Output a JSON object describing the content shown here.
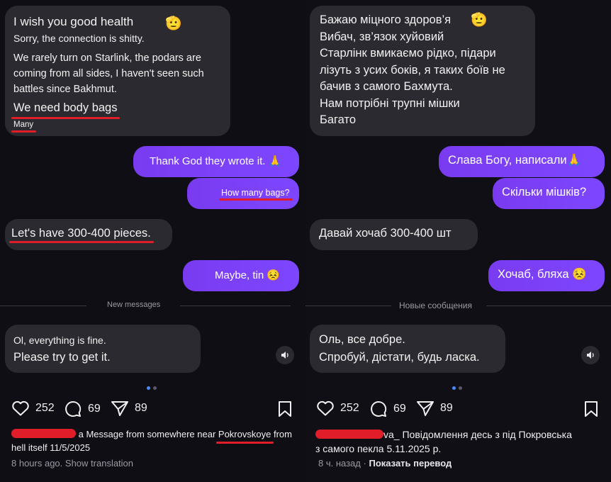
{
  "left": {
    "bubble1": {
      "line1": "I wish you good health",
      "line2": "Sorry, the connection is shitty.",
      "line3": "We rarely turn on Starlink, the podars are",
      "line4": "coming from all sides, I haven't seen such",
      "line5": "battles since Bakhmut.",
      "line6": "We need body bags",
      "line7": "Many"
    },
    "out1": "Thank God they wrote it.",
    "out2": "How many bags?",
    "in2": "Let's have 300-400 pieces.",
    "out3": "Maybe, tin",
    "divider": "New messages",
    "bubble3": {
      "line1": "Ol, everything is fine.",
      "line2": "Please try to get it."
    },
    "likes": "252",
    "comments": "69",
    "shares": "89",
    "caption_pre": "a Message from somewhere near",
    "caption_place": "Pokrovskoye",
    "caption_post": "from",
    "caption_line2": "hell itself 11/5/2025",
    "time": "8 hours ago.",
    "show_translation": "Show translation"
  },
  "right": {
    "bubble1": {
      "line1": "Бажаю міцного здоров’я",
      "line2": "Вибач, зв’язок хуйовий",
      "line3": "Старлінк вмикаємо рідко, підари",
      "line4": "лізуть з усих боків, я таких боїв не",
      "line5": "бачив з самого Бахмута.",
      "line6": "Нам потрібні трупні мішки",
      "line7": "Багато"
    },
    "out1": "Слава Богу, написали",
    "out2": "Скільки мішків?",
    "in2": "Давай хочаб 300-400 шт",
    "out3": "Хочаб, бляха",
    "divider": "Новые сообщения",
    "bubble3": {
      "line1": "Оль, все добре.",
      "line2": "Спробуй, дістати, будь ласка."
    },
    "likes": "252",
    "comments": "69",
    "shares": "89",
    "caption_user_tail": "va_",
    "caption_line1": "Повідомлення десь з під Покровська",
    "caption_line2": "з самого пекла 5.11.2025 р.",
    "time": "8 ч. назад",
    "show_translation": "Показать перевод"
  },
  "colors": {
    "bubble_in": "#2a2a30",
    "bubble_out": "#7a3bf0",
    "highlight": "#e11d2a",
    "dot_active": "#4a8cff"
  },
  "icons": [
    "saluting-face-emoji",
    "folded-hands-emoji",
    "persevering-face-emoji",
    "speaker-icon",
    "heart-icon",
    "comment-icon",
    "share-icon",
    "bookmark-icon"
  ]
}
